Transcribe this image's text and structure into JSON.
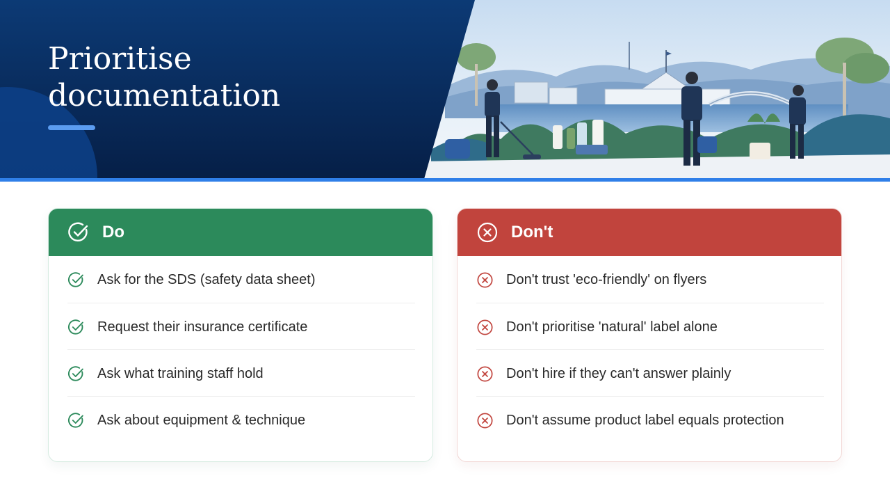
{
  "slide": {
    "title": "Prioritise documentation"
  },
  "colors": {
    "navy": "#0a2f63",
    "accent_blue": "#2f7fe8",
    "do_green": "#2c8a5b",
    "dont_red": "#c1443d"
  },
  "do_card": {
    "heading": "Do",
    "icon": "check-circle-icon",
    "items": [
      "Ask for the SDS (safety data sheet)",
      "Request their insurance certificate",
      "Ask what training staff hold",
      "Ask about equipment & technique"
    ]
  },
  "dont_card": {
    "heading": "Don't",
    "icon": "x-circle-icon",
    "items": [
      "Don't trust 'eco-friendly' on flyers",
      "Don't prioritise 'natural' label alone",
      "Don't hire if they can't answer plainly",
      "Don't assume product label equals protection"
    ]
  }
}
